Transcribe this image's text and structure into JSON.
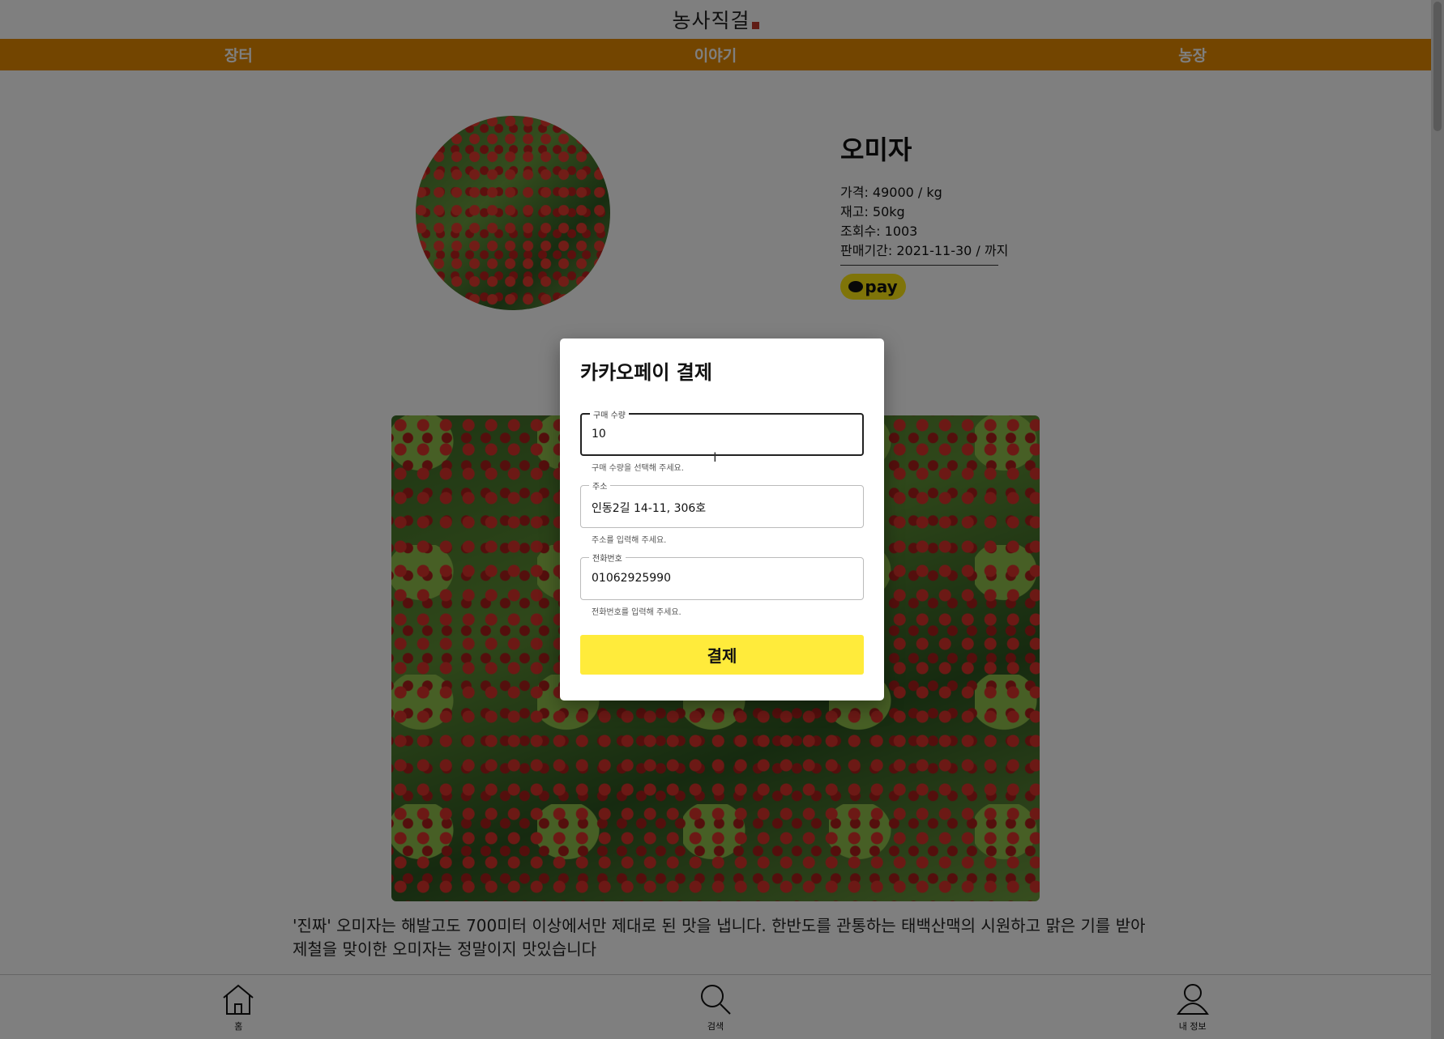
{
  "header": {
    "logo_text": "농사직걸"
  },
  "nav": {
    "items": [
      {
        "label": "장터"
      },
      {
        "label": "이야기"
      },
      {
        "label": "농장"
      }
    ]
  },
  "product": {
    "title": "오미자",
    "price": "가격: 49000 / kg",
    "stock": "재고: 50kg",
    "views": "조회수: 1003",
    "sale_period": "판매기간: 2021-11-30 / 까지",
    "pay_button_label": "pay"
  },
  "description": "'진짜' 오미자는 해발고도 700미터 이상에서만 제대로 된 맛을 냅니다. 한반도를 관통하는 태백산맥의 시원하고 맑은 기를 받아 제철을 맞이한 오미자는 정말이지 맛있습니다",
  "bottom_nav": {
    "items": [
      {
        "label": "홈",
        "icon": "home-icon"
      },
      {
        "label": "검색",
        "icon": "search-icon"
      },
      {
        "label": "내 정보",
        "icon": "user-icon"
      }
    ]
  },
  "modal": {
    "title": "카카오페이 결제",
    "quantity": {
      "label": "구매 수량",
      "value": "10",
      "helper": "구매 수량을 선택해 주세요."
    },
    "address": {
      "label": "주소",
      "value": "인동2길 14-11, 306호",
      "helper": "주소를 입력해 주세요."
    },
    "phone": {
      "label": "전화번호",
      "value": "01062925990",
      "helper": "전화번호를 입력해 주세요."
    },
    "submit_label": "결제"
  },
  "colors": {
    "nav_bg": "#e68a00",
    "kakao_yellow": "#ffeb3b",
    "pay_yellow": "#ffe812"
  }
}
